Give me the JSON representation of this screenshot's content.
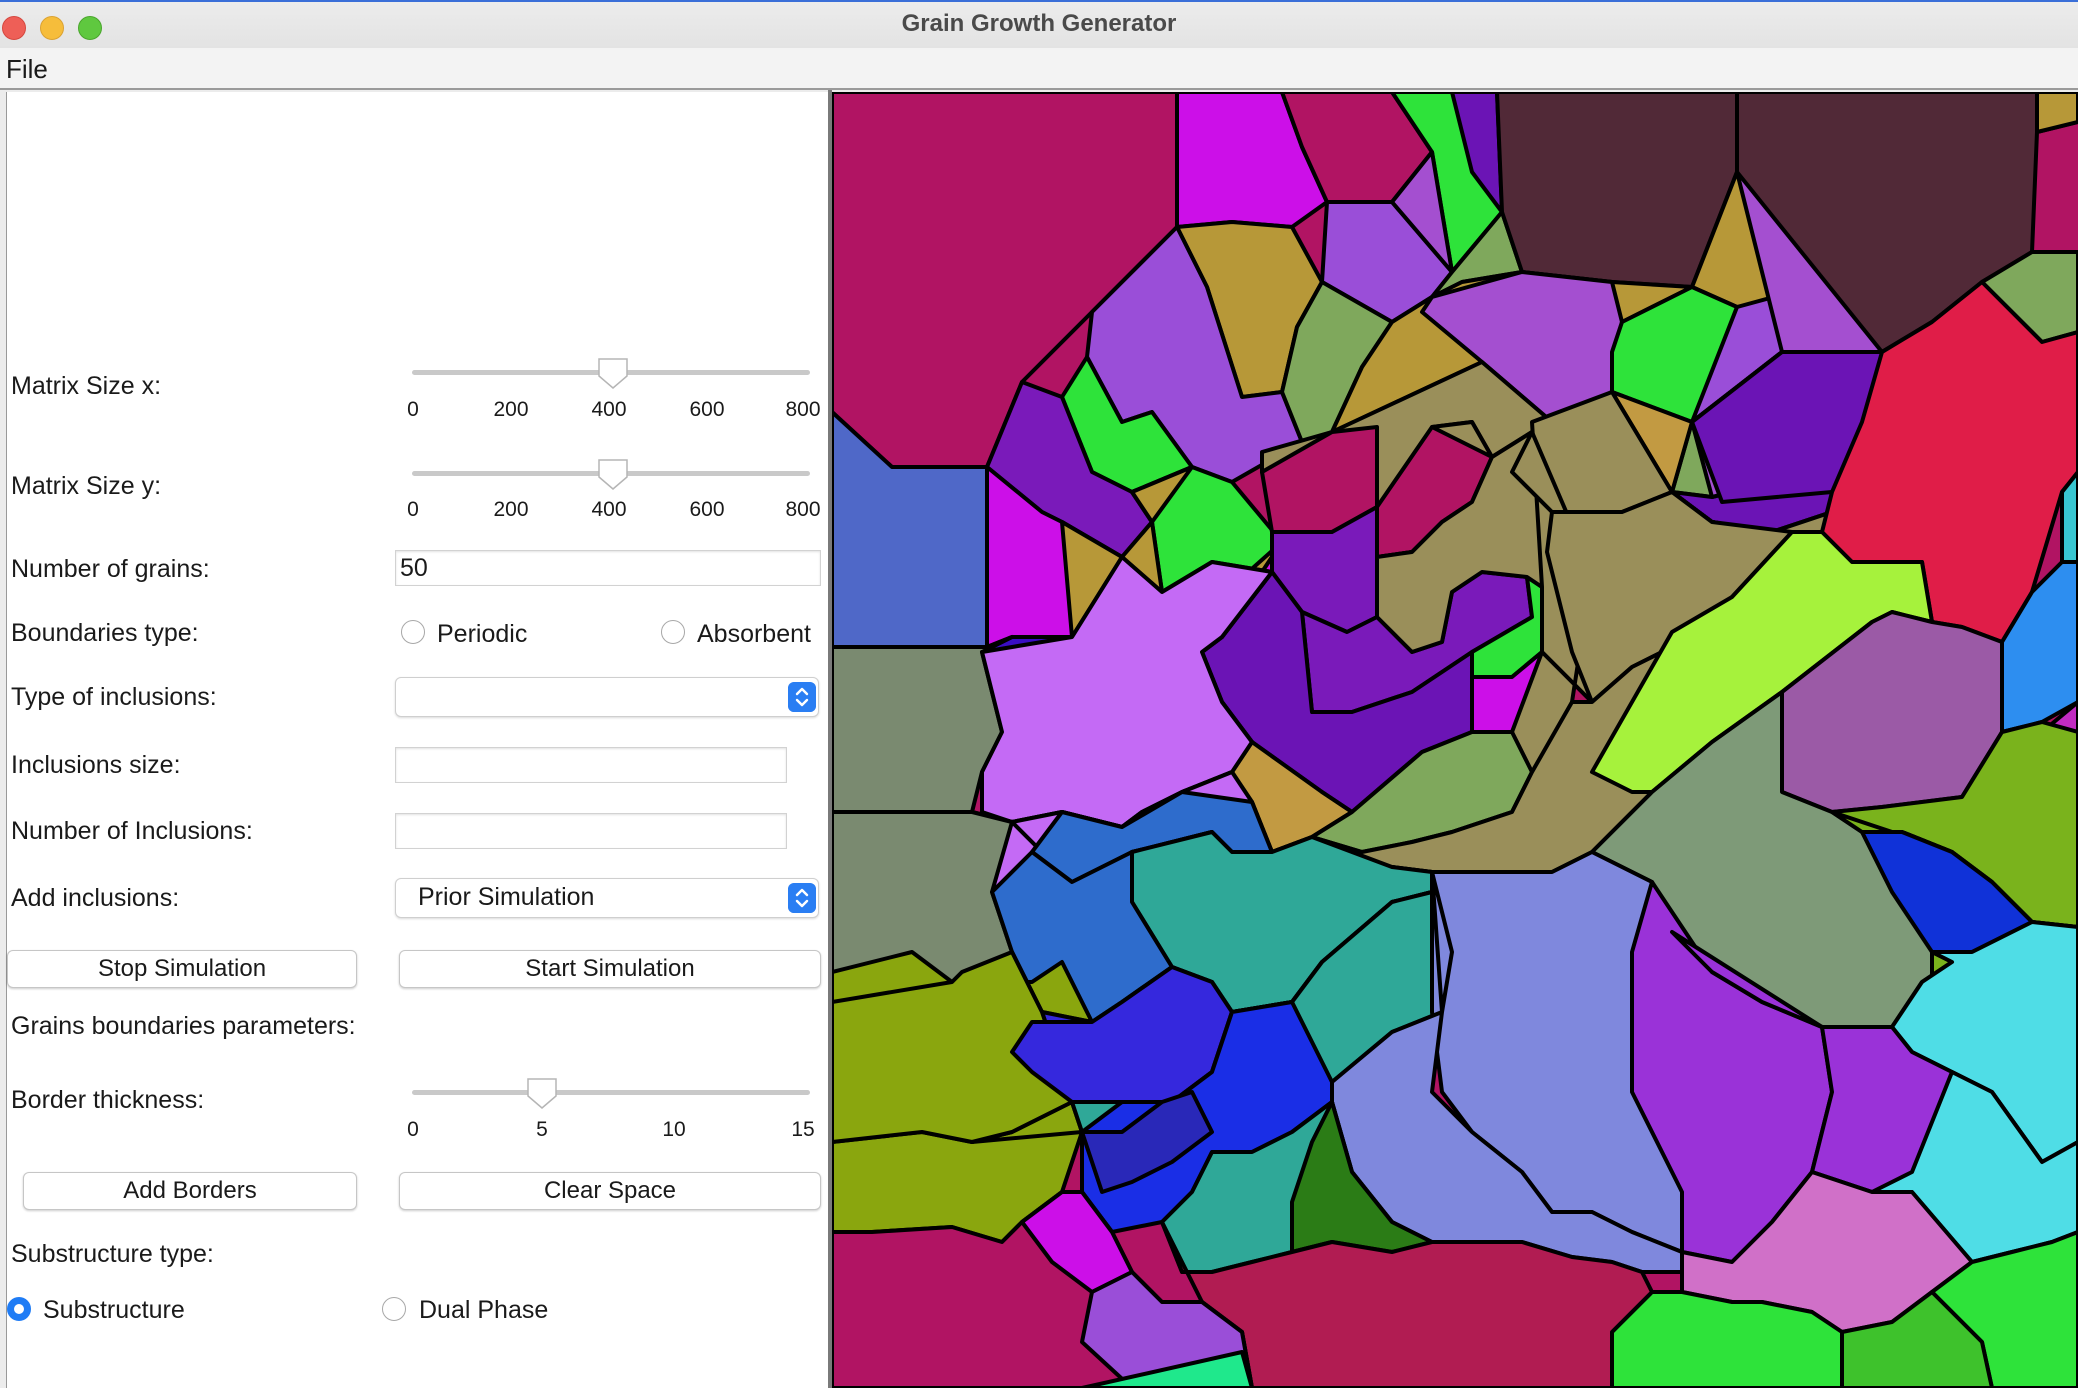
{
  "window": {
    "title": "Grain Growth Generator"
  },
  "menu": {
    "file": "File"
  },
  "controls": {
    "matrix_x": {
      "label": "Matrix Size x:",
      "ticks": [
        "0",
        "200",
        "400",
        "600",
        "800"
      ],
      "value": 400
    },
    "matrix_y": {
      "label": "Matrix Size y:",
      "ticks": [
        "0",
        "200",
        "400",
        "600",
        "800"
      ],
      "value": 400
    },
    "grains": {
      "label": "Number of grains:",
      "value": "50"
    },
    "boundaries": {
      "label": "Boundaries type:",
      "opt1": "Periodic",
      "opt2": "Absorbent"
    },
    "inclusion_type": {
      "label": "Type of inclusions:",
      "value": ""
    },
    "inclusion_size": {
      "label": "Inclusions size:",
      "value": ""
    },
    "inclusion_count": {
      "label": "Number of Inclusions:",
      "value": ""
    },
    "add_inclusions": {
      "label": "Add inclusions:",
      "value": "Prior Simulation"
    },
    "stop_button": "Stop Simulation",
    "start_button": "Start Simulation",
    "gb_params": "Grains boundaries parameters:",
    "border": {
      "label": "Border thickness:",
      "ticks": [
        "0",
        "5",
        "10",
        "15"
      ],
      "value": 5
    },
    "add_borders": "Add Borders",
    "clear_space": "Clear Space",
    "substructure": {
      "label": "Substructure  type:",
      "opt1": "Substructure",
      "opt2": "Dual Phase",
      "selected": "Substructure"
    }
  },
  "colors": {
    "accent": "#1f7cf5",
    "border": "#000000"
  }
}
